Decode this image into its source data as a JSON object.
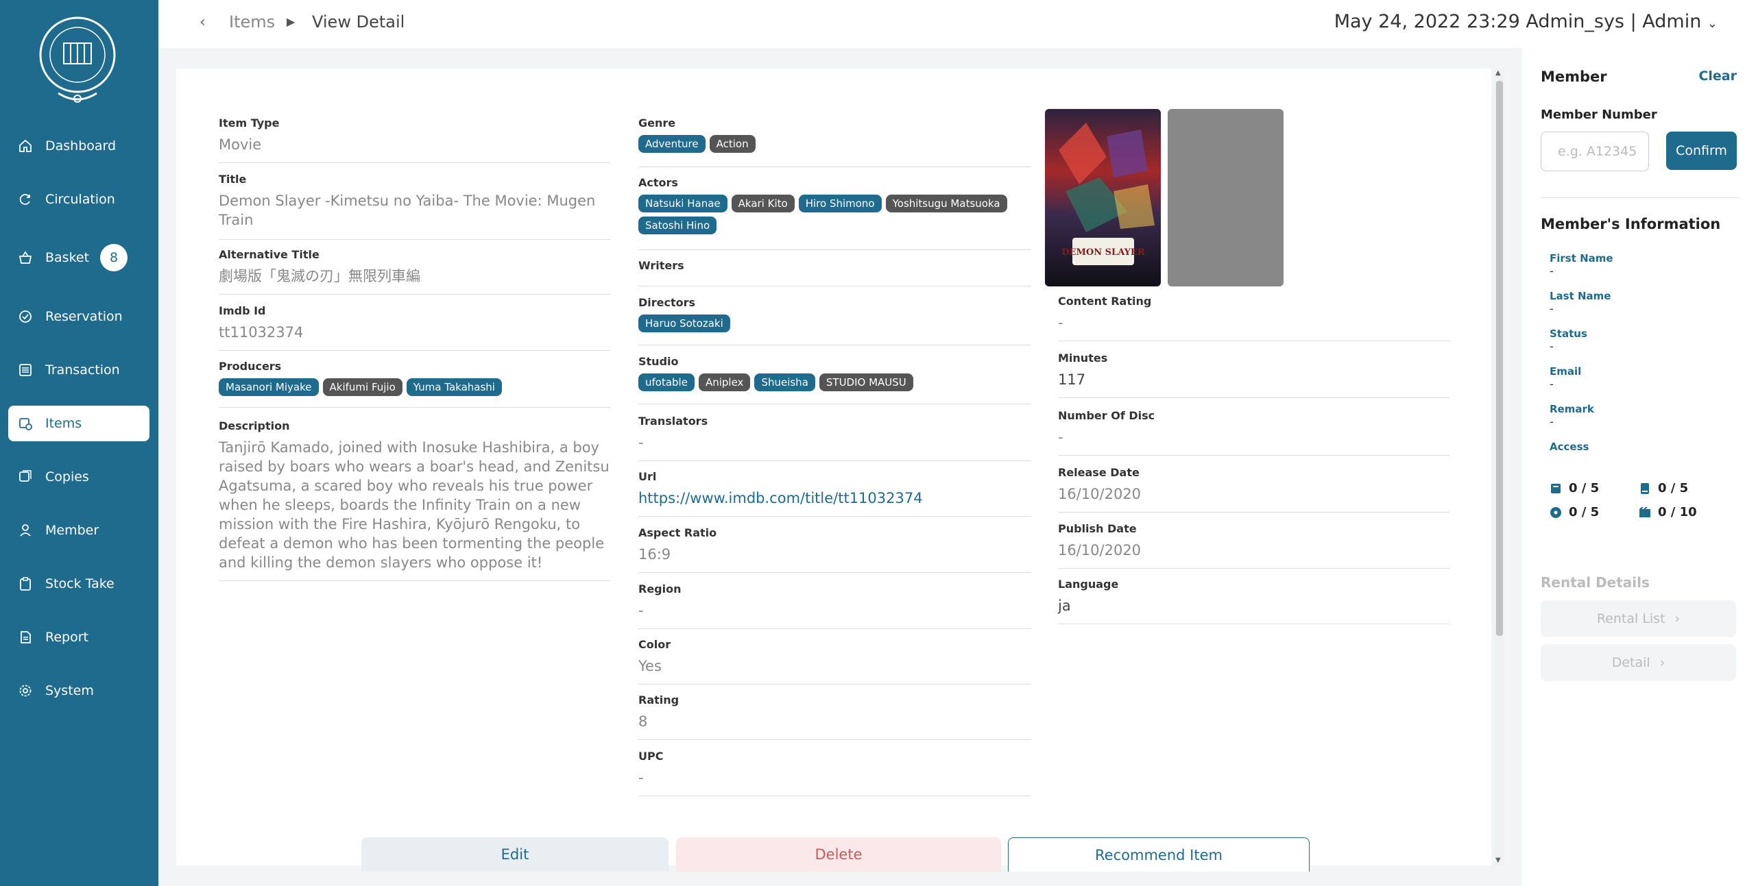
{
  "sidebar": {
    "items": [
      {
        "label": "Dashboard",
        "icon": "home-icon"
      },
      {
        "label": "Circulation",
        "icon": "refresh-icon"
      },
      {
        "label": "Basket",
        "icon": "basket-icon",
        "badge": "8"
      },
      {
        "label": "Reservation",
        "icon": "check-circle-icon"
      },
      {
        "label": "Transaction",
        "icon": "list-icon"
      },
      {
        "label": "Items",
        "icon": "items-icon",
        "active": true
      },
      {
        "label": "Copies",
        "icon": "copies-icon"
      },
      {
        "label": "Member",
        "icon": "user-icon"
      },
      {
        "label": "Stock Take",
        "icon": "clipboard-icon"
      },
      {
        "label": "Report",
        "icon": "document-icon"
      },
      {
        "label": "System",
        "icon": "gear-icon"
      }
    ]
  },
  "header": {
    "breadcrumb1": "Items",
    "breadcrumb2": "View Detail",
    "right": "May 24, 2022 23:29  Admin_sys  | Admin"
  },
  "item": {
    "item_type": {
      "label": "Item Type",
      "value": "Movie"
    },
    "title": {
      "label": "Title",
      "value": "Demon Slayer -Kimetsu no Yaiba- The Movie: Mugen Train"
    },
    "alt_title": {
      "label": "Alternative Title",
      "value": "劇場版「鬼滅の刃」無限列車編"
    },
    "imdb": {
      "label": "Imdb Id",
      "value": "tt11032374"
    },
    "producers": {
      "label": "Producers",
      "tags": [
        "Masanori Miyake",
        "Akifumi Fujio",
        "Yuma Takahashi"
      ]
    },
    "description": {
      "label": "Description",
      "value": "Tanjirō Kamado, joined with Inosuke Hashibira, a boy raised by boars who wears a boar's head, and Zenitsu Agatsuma, a scared boy who reveals his true power when he sleeps, boards the Infinity Train on a new mission with the Fire Hashira, Kyōjurō Rengoku, to defeat a demon who has been tormenting the people and killing the demon slayers who oppose it!"
    },
    "genre": {
      "label": "Genre",
      "tags": [
        "Adventure",
        "Action"
      ]
    },
    "actors": {
      "label": "Actors",
      "tags": [
        "Natsuki Hanae",
        "Akari Kito",
        "Hiro Shimono",
        "Yoshitsugu Matsuoka",
        "Satoshi Hino"
      ]
    },
    "writers": {
      "label": "Writers"
    },
    "directors": {
      "label": "Directors",
      "tags": [
        "Haruo Sotozaki"
      ]
    },
    "studio": {
      "label": "Studio",
      "tags": [
        "ufotable",
        "Aniplex",
        "Shueisha",
        "STUDIO MAUSU"
      ]
    },
    "translators": {
      "label": "Translators",
      "value": "-"
    },
    "url": {
      "label": "Url",
      "value": "https://www.imdb.com/title/tt11032374"
    },
    "aspect_ratio": {
      "label": "Aspect Ratio",
      "value": "16:9"
    },
    "region": {
      "label": "Region",
      "value": "-"
    },
    "color": {
      "label": "Color",
      "value": "Yes"
    },
    "rating": {
      "label": "Rating",
      "value": "8"
    },
    "upc": {
      "label": "UPC",
      "value": "-"
    },
    "content_rating": {
      "label": "Content Rating",
      "value": "-"
    },
    "minutes": {
      "label": "Minutes",
      "value": "117"
    },
    "discs": {
      "label": "Number Of Disc",
      "value": "-"
    },
    "release_date": {
      "label": "Release Date",
      "value": "16/10/2020"
    },
    "publish_date": {
      "label": "Publish Date",
      "value": "16/10/2020"
    },
    "language": {
      "label": "Language",
      "value": "ja"
    },
    "poster_text": "DEMON SLAYER"
  },
  "buttons": {
    "edit": "Edit",
    "delete": "Delete",
    "recommend": "Recommend Item"
  },
  "member_panel": {
    "title": "Member",
    "clear": "Clear",
    "number_label": "Member Number",
    "number_placeholder": "e.g. A12345",
    "confirm": "Confirm",
    "info_title": "Member's Information",
    "fields": [
      {
        "label": "First Name",
        "value": "-"
      },
      {
        "label": "Last Name",
        "value": "-"
      },
      {
        "label": "Status",
        "value": "-"
      },
      {
        "label": "Email",
        "value": "-"
      },
      {
        "label": "Remark",
        "value": "-"
      },
      {
        "label": "Access"
      }
    ],
    "quotas": [
      {
        "icon": "book-stack-icon",
        "value": "0 / 5"
      },
      {
        "icon": "book-icon",
        "value": "0 / 5"
      },
      {
        "icon": "disc-icon",
        "value": "0 / 5"
      },
      {
        "icon": "film-icon",
        "value": "0 / 10"
      }
    ],
    "rental_title": "Rental Details",
    "rental_list": "Rental List",
    "detail": "Detail"
  },
  "colors": {
    "primary": "#1f6b8e",
    "tag_gray": "#555555",
    "delete": "#d05757"
  }
}
